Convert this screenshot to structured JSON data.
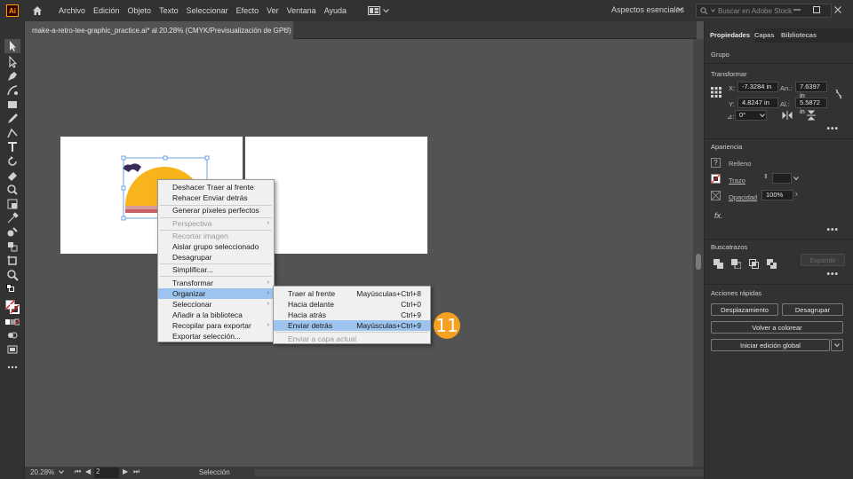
{
  "menubar": {
    "logo": "Ai",
    "items": [
      "Archivo",
      "Edición",
      "Objeto",
      "Texto",
      "Seleccionar",
      "Efecto",
      "Ver",
      "Ventana",
      "Ayuda"
    ],
    "workspace": "Aspectos esenciales",
    "stock_search_placeholder": "Buscar en Adobe Stock"
  },
  "document_tab": {
    "title": "make-a-retro-tee-graphic_practice.ai* al 20.28% (CMYK/Previsualización de GPU)",
    "close": "×"
  },
  "context_menu": {
    "items": [
      {
        "label": "Deshacer Traer al frente",
        "disabled": false
      },
      {
        "label": "Rehacer Enviar detrás",
        "disabled": false
      },
      {
        "label": "Generar píxeles perfectos",
        "disabled": false
      },
      {
        "label": "Perspectiva",
        "disabled": true,
        "submenu": true
      },
      {
        "label": "Recortar imagen",
        "disabled": true
      },
      {
        "label": "Aislar grupo seleccionado",
        "disabled": false
      },
      {
        "label": "Desagrupar",
        "disabled": false
      },
      {
        "label": "Simplificar...",
        "disabled": false
      },
      {
        "label": "Transformar",
        "disabled": false,
        "submenu": true
      },
      {
        "label": "Organizar",
        "disabled": false,
        "submenu": true,
        "active": true
      },
      {
        "label": "Seleccionar",
        "disabled": false,
        "submenu": true
      },
      {
        "label": "Añadir a la biblioteca",
        "disabled": false
      },
      {
        "label": "Recopilar para exportar",
        "disabled": false,
        "submenu": true
      },
      {
        "label": "Exportar selección...",
        "disabled": false
      }
    ]
  },
  "submenu": {
    "items": [
      {
        "label": "Traer al frente",
        "shortcut": "Mayúsculas+Ctrl+8"
      },
      {
        "label": "Hacia delante",
        "shortcut": "Ctrl+0"
      },
      {
        "label": "Hacia atrás",
        "shortcut": "Ctrl+9"
      },
      {
        "label": "Enviar detrás",
        "shortcut": "Mayúsculas+Ctrl+9",
        "active": true
      },
      {
        "label": "Enviar a capa actual",
        "shortcut": "",
        "disabled": true
      }
    ]
  },
  "step_badge": "11",
  "statusbar": {
    "zoom": "20.28%",
    "artboard": "2",
    "mode": "Selección"
  },
  "panel": {
    "tabs": [
      "Propiedades",
      "Capas",
      "Bibliotecas"
    ],
    "object_type": "Grupo",
    "transform": {
      "title": "Transformar",
      "x_label": "X:",
      "x": "-7.3284 in",
      "y_label": "Y:",
      "y": "4.8247 in",
      "w_label": "An.:",
      "w": "7.6397 in",
      "h_label": "Al.:",
      "h": "5.5872 in",
      "angle_label": "⊿:",
      "angle": "0°"
    },
    "appearance": {
      "title": "Apariencia",
      "fill": "Relleno",
      "stroke": "Trazo",
      "opacity_label": "Opacidad",
      "opacity": "100%",
      "fx": "fx."
    },
    "pathfinder": {
      "title": "Buscatrazos",
      "expand": "Expandir"
    },
    "quick_actions": {
      "title": "Acciones rápidas",
      "offset": "Desplazamiento",
      "ungroup": "Desagrupar",
      "recolor": "Volver a colorear",
      "global_edit": "Iniciar edición global"
    }
  },
  "colors": {
    "accent_orange": "#f5a020",
    "menu_highlight": "#9cc4ee",
    "sun_yellow": "#f7b51b",
    "purple_text": "#3a2a5c"
  }
}
